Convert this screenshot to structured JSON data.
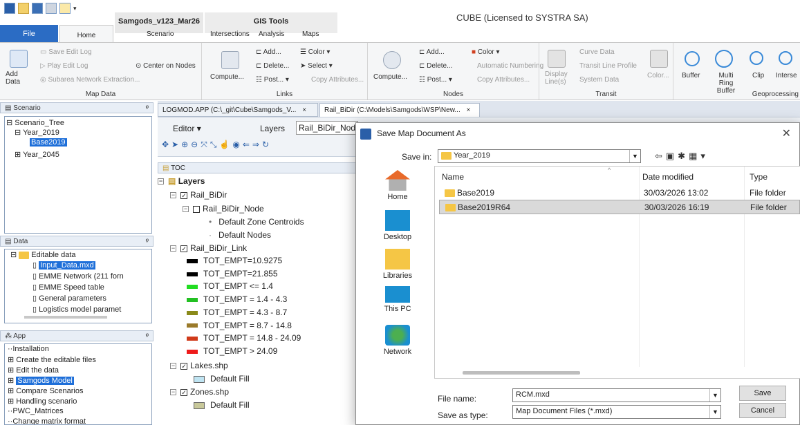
{
  "title_bar": {
    "document_tab": "Samgods_v123_Mar26",
    "tool_tab": "GIS Tools",
    "app_title": "CUBE (Licensed to SYSTRA SA)"
  },
  "ribbon_tabs": [
    "File",
    "Home",
    "Scenario",
    "Intersections",
    "Analysis",
    "Maps"
  ],
  "ribbon": {
    "map_data": {
      "label": "Map Data",
      "add_data": "Add Data",
      "save_edit_log": "Save Edit Log",
      "play_edit_log": "Play Edit Log",
      "subarea": "Subarea Network Extraction...",
      "center_on_nodes": "Center on Nodes"
    },
    "links": {
      "label": "Links",
      "compute": "Compute...",
      "add": "Add...",
      "delete": "Delete...",
      "post": "Post...",
      "color": "Color",
      "select": "Select",
      "copy_attributes": "Copy Attributes..."
    },
    "nodes": {
      "label": "Nodes",
      "compute": "Compute...",
      "add": "Add...",
      "delete": "Delete...",
      "post": "Post...",
      "color": "Color",
      "automatic_numbering": "Automatic Numbering",
      "copy_attributes": "Copy Attributes..."
    },
    "transit": {
      "label": "Transit",
      "display_lines": "Display Line(s)",
      "curve_data": "Curve Data",
      "transit_line_profile": "Transit Line Profile",
      "system_data": "System Data",
      "color": "Color..."
    },
    "geoprocessing": {
      "label": "Geoprocessing",
      "buffer": "Buffer",
      "multi_ring_buffer": "Multi Ring Buffer",
      "clip": "Clip",
      "intersect": "Interse"
    }
  },
  "scenario_pane": {
    "header": "Scenario",
    "items": [
      "Scenario_Tree",
      "Year_2019",
      "Base2019",
      "Year_2045"
    ]
  },
  "data_pane": {
    "header": "Data",
    "items": [
      "Editable data",
      "Input_Data.mxd",
      "EMME Network (211 forn",
      "EMME Speed table",
      "General parameters",
      "Logistics model paramet"
    ]
  },
  "app_pane": {
    "header": "App",
    "items": [
      "Installation",
      "Create the editable files",
      "Edit the data",
      "Samgods Model",
      "Compare Scenarios",
      "Handling scenario",
      "PWC_Matrices",
      "Change matrix format"
    ]
  },
  "doc_tabs": [
    {
      "label": "LOGMOD.APP (C:\\_git\\Cube\\Samgods_V...",
      "close": "×"
    },
    {
      "label": "Rail_BiDir (C:\\Models\\Samgods\\WSP\\New...",
      "close": "×"
    }
  ],
  "editor_toolbar": {
    "editor": "Editor",
    "layers_label": "Layers",
    "layers_value": "Rail_BiDir_Nod"
  },
  "toc": {
    "header": "TOC",
    "root": "Layers",
    "group": "Rail_BiDir",
    "node_layer": "Rail_BiDir_Node",
    "node_items": [
      "Default Zone Centroids",
      "Default Nodes"
    ],
    "link_layer": "Rail_BiDir_Link",
    "link_classes": [
      {
        "label": "TOT_EMPT=10.9275",
        "color": "#000000"
      },
      {
        "label": "TOT_EMPT=21.855",
        "color": "#000000"
      },
      {
        "label": "TOT_EMPT <= 1.4",
        "color": "#22dd22"
      },
      {
        "label": "TOT_EMPT = 1.4 - 4.3",
        "color": "#22c022"
      },
      {
        "label": "TOT_EMPT = 4.3 - 8.7",
        "color": "#8a8a1a"
      },
      {
        "label": "TOT_EMPT = 8.7 - 14.8",
        "color": "#9a7a2a"
      },
      {
        "label": "TOT_EMPT = 14.8 - 24.09",
        "color": "#d03a1a"
      },
      {
        "label": "TOT_EMPT > 24.09",
        "color": "#ee1a1a"
      }
    ],
    "lakes": "Lakes.shp",
    "lakes_fill": "Default Fill",
    "zones": "Zones.shp",
    "zones_fill": "Default Fill"
  },
  "dialog": {
    "title": "Save Map Document As",
    "save_in_label": "Save in:",
    "save_in_value": "Year_2019",
    "places": [
      "Home",
      "Desktop",
      "Libraries",
      "This PC",
      "Network"
    ],
    "columns": [
      "Name",
      "Date modified",
      "Type"
    ],
    "files": [
      {
        "name": "Base2019",
        "date": "30/03/2026 13:02",
        "type": "File folder"
      },
      {
        "name": "Base2019R64",
        "date": "30/03/2026 16:19",
        "type": "File folder"
      }
    ],
    "file_name_label": "File name:",
    "file_name_value": "RCM.mxd",
    "save_as_type_label": "Save as type:",
    "save_as_type_value": "Map Document Files (*.mxd)",
    "save_button": "Save",
    "cancel_button": "Cancel"
  }
}
